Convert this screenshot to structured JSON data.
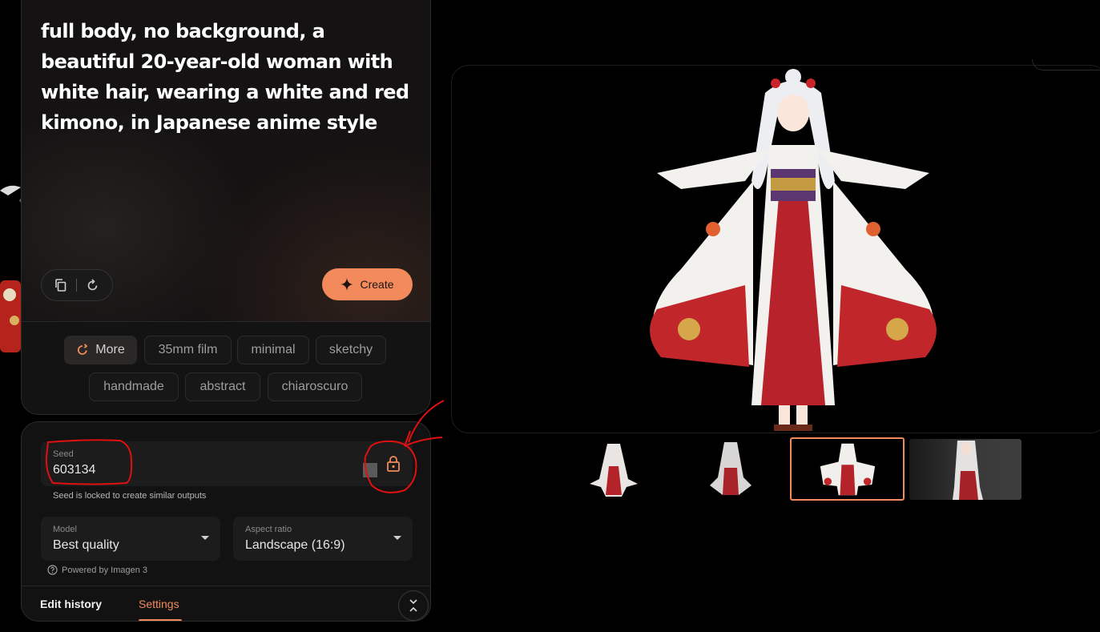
{
  "prompt": {
    "text": "full body, no background, a beautiful 20-year-old woman with white hair, wearing a white and red kimono, in Japanese anime style",
    "create_label": "Create"
  },
  "chips": [
    {
      "label": "More"
    },
    {
      "label": "35mm film"
    },
    {
      "label": "minimal"
    },
    {
      "label": "sketchy"
    },
    {
      "label": "handmade"
    },
    {
      "label": "abstract"
    },
    {
      "label": "chiaroscuro"
    }
  ],
  "settings": {
    "seed_label": "Seed",
    "seed_value": "603134",
    "seed_note": "Seed is locked to create similar outputs",
    "model_label": "Model",
    "model_value": "Best quality",
    "aspect_label": "Aspect ratio",
    "aspect_value": "Landscape (16:9)",
    "powered_by": "Powered by Imagen 3"
  },
  "tabs": {
    "history": "Edit history",
    "settings": "Settings",
    "active": "Settings"
  },
  "thumbnails": {
    "count": 4,
    "selected_index": 2
  },
  "colors": {
    "accent": "#f28a5c",
    "annotation": "#e01010",
    "background": "#000000",
    "card": "#141212"
  },
  "icons": [
    "copy-icon",
    "refresh-icon",
    "sparkle-icon",
    "lock-icon",
    "help-circle-icon",
    "expand-collapse-icon"
  ]
}
